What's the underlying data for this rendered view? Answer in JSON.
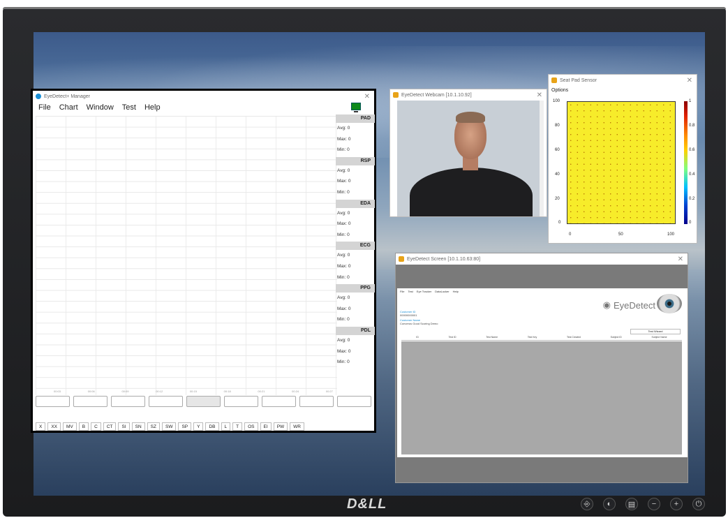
{
  "monitor": {
    "brand": "D&LL"
  },
  "bezel_buttons": [
    "⎆",
    "◐",
    "▤",
    "−",
    "+",
    "⏻"
  ],
  "manager": {
    "title": "EyeDetect+ Manager",
    "menu": [
      "File",
      "Chart",
      "Window",
      "Test",
      "Help"
    ],
    "sensors": [
      {
        "name": "PAD",
        "avg": "Avg: 0",
        "max": "Max: 0",
        "min": "Min: 0"
      },
      {
        "name": "RSP",
        "avg": "Avg: 0",
        "max": "Max: 0",
        "min": "Min: 0"
      },
      {
        "name": "EDA",
        "avg": "Avg: 0",
        "max": "Max: 0",
        "min": "Min: 0"
      },
      {
        "name": "ECG",
        "avg": "Avg: 0",
        "max": "Max: 0",
        "min": "Min: 0"
      },
      {
        "name": "PPG",
        "avg": "Avg: 0",
        "max": "Max: 0",
        "min": "Min: 0"
      },
      {
        "name": "PDL",
        "avg": "Avg: 0",
        "max": "Max: 0",
        "min": "Min: 0"
      }
    ],
    "time_labels": [
      "00:03",
      "00:06",
      "00:09",
      "00:12",
      "00:15",
      "00:18",
      "00:21",
      "00:24",
      "00:27"
    ],
    "tags": [
      "X",
      "XX",
      "MV",
      "B",
      "C",
      "CT",
      "SI",
      "SN",
      "SZ",
      "SW",
      "SP",
      "Y",
      "DB",
      "L",
      "T",
      "OS",
      "EI",
      "PW",
      "WR"
    ]
  },
  "webcam": {
    "title": "EyeDetect Webcam [10.1.10.92]"
  },
  "seat_pad": {
    "title": "Seat Pad Sensor",
    "options": "Options",
    "yticks": [
      "100",
      "80",
      "60",
      "40",
      "20",
      "0"
    ],
    "xticks": [
      "0",
      "50",
      "100"
    ],
    "cbar_ticks": [
      "1",
      "0.8",
      "0.6",
      "0.4",
      "0.2",
      "0"
    ]
  },
  "screen_window": {
    "title": "EyeDetect Screen [10.1.10.63:80]",
    "inner_menu": [
      "File",
      "Test",
      "Eye Tracker",
      "DataLocker",
      "Help"
    ],
    "customer_id_label": "Customer ID",
    "customer_id_value": "00000000001",
    "customer_name_label": "Customer Name",
    "customer_name_value": "Converus Good Scoring Demo",
    "brand_text": "EyeDetect",
    "test_wizard": "Test Wizard",
    "columns": [
      "ID",
      "Test ID",
      "Test Name",
      "Test Key",
      "Test Created",
      "Subject ID",
      "Subject Name"
    ]
  }
}
